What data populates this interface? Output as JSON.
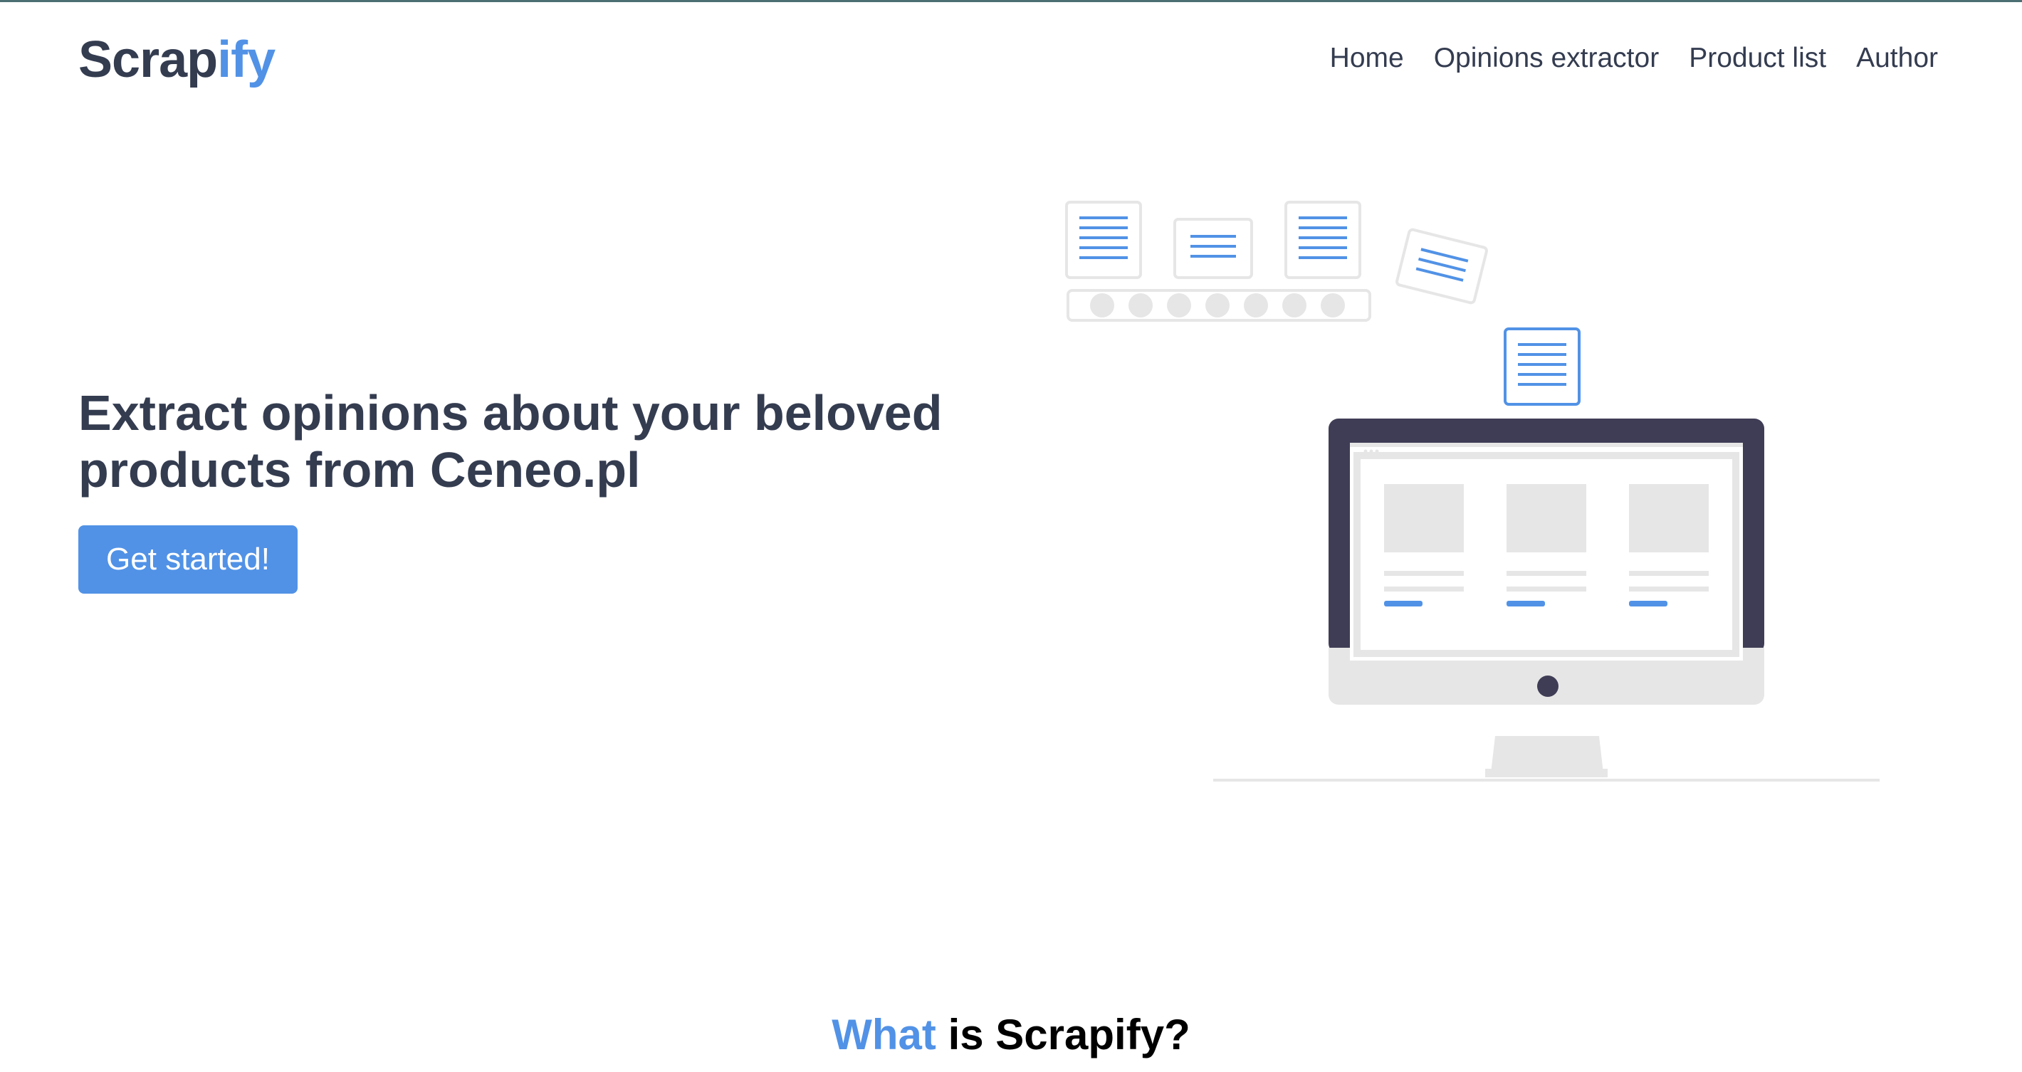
{
  "header": {
    "brand_prefix": "Scrap",
    "brand_accent": "ify",
    "nav": [
      {
        "label": "Home"
      },
      {
        "label": "Opinions extractor"
      },
      {
        "label": "Product list"
      },
      {
        "label": "Author"
      }
    ]
  },
  "hero": {
    "title": "Extract opinions about your beloved products from Ceneo.pl",
    "cta_label": "Get started!"
  },
  "section": {
    "title_accent": "What",
    "title_rest": " is Scrapify?"
  },
  "colors": {
    "accent": "#5192e6",
    "text": "#343c50",
    "monitor_frame": "#3f3d56",
    "placeholder_gray": "#e6e6e6"
  },
  "illustration": {
    "description_icon": "documents-conveyor-to-monitor-illustration"
  }
}
